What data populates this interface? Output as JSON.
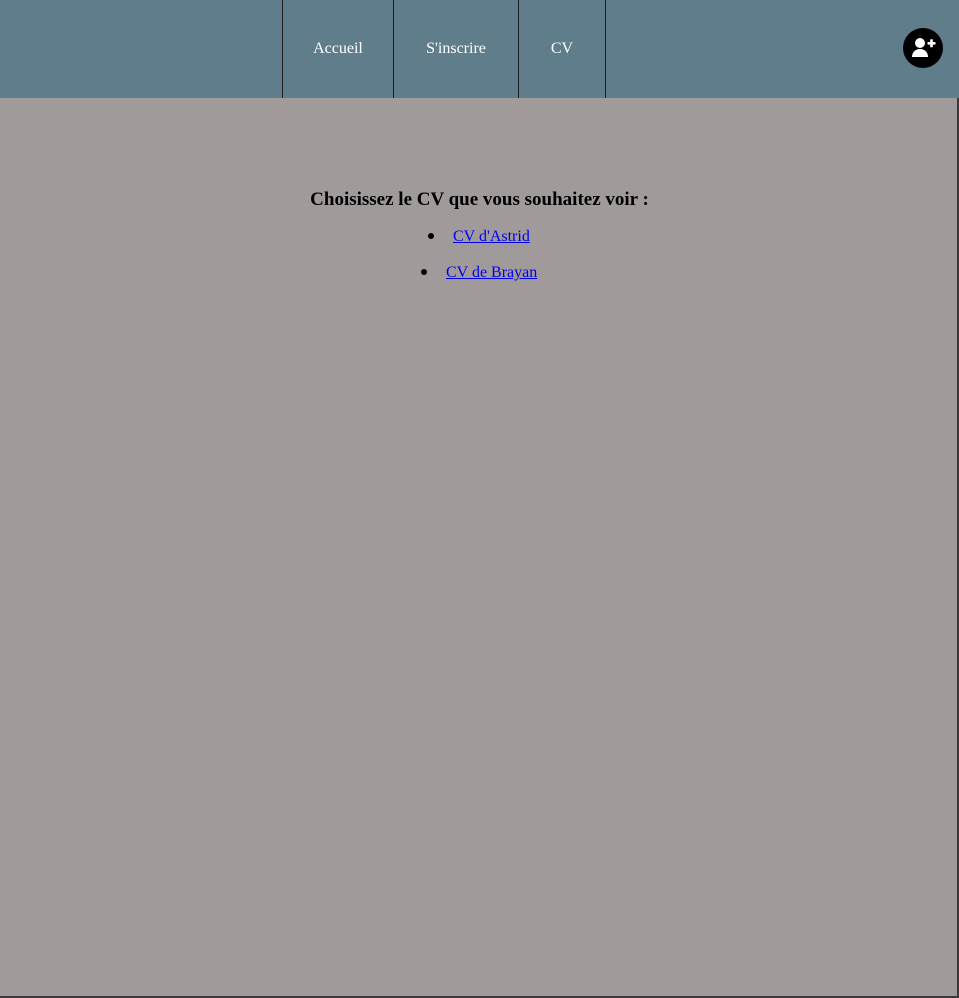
{
  "nav": {
    "items": [
      {
        "label": "Accueil"
      },
      {
        "label": "S'inscrire"
      },
      {
        "label": "CV"
      }
    ],
    "add_user_icon": "add-user-icon"
  },
  "main": {
    "title": "Choisissez le CV que vous souhaitez voir :",
    "cv_links": [
      {
        "label": "CV d'Astrid"
      },
      {
        "label": "CV de Brayan"
      }
    ]
  },
  "colors": {
    "header_bg": "#607d8b",
    "page_bg": "#a09a9a",
    "link": "#0000ee",
    "nav_text": "#ffffff"
  }
}
